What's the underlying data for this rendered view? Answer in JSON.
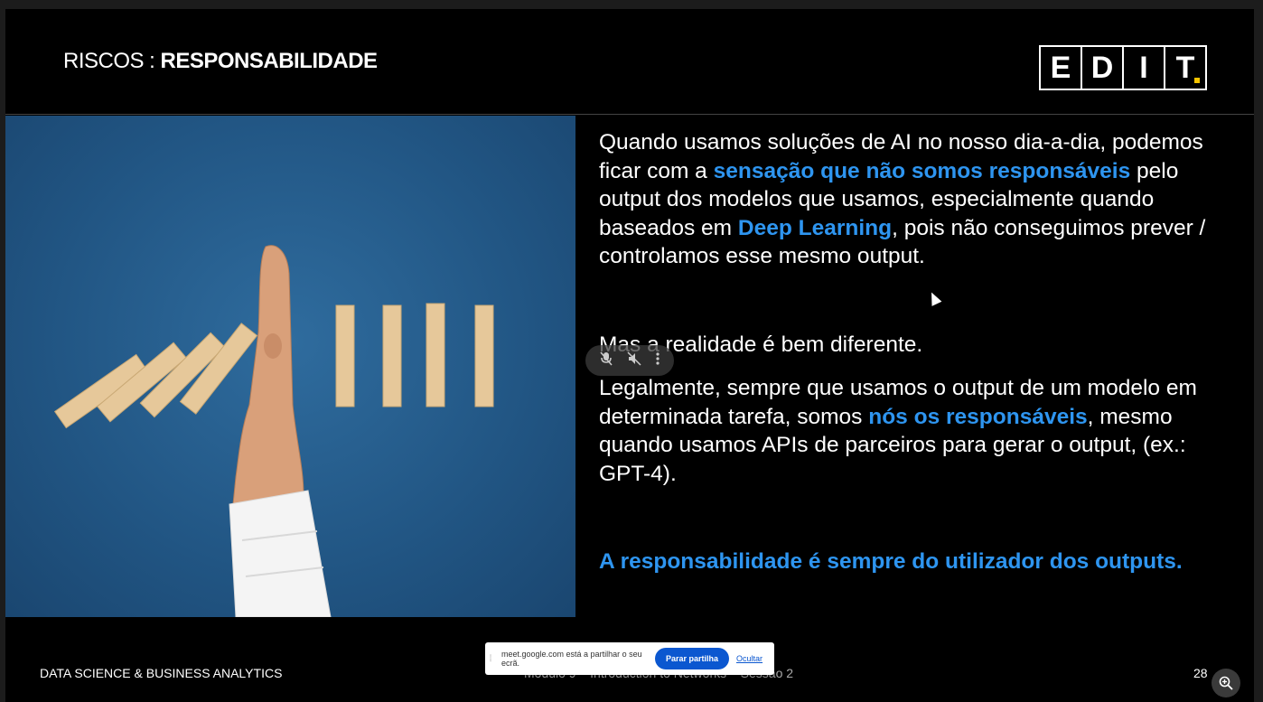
{
  "slide": {
    "title_prefix": "RISCOS : ",
    "title_bold": "RESPONSABILIDADE",
    "logo_letters": [
      "E",
      "D",
      "I",
      "T"
    ],
    "logo_dot_color": "#f5c400",
    "paragraph1": {
      "part1": "Quando usamos soluções de AI no nosso dia-a-dia, podemos ficar com a ",
      "hl1": "sensação que não somos responsáveis",
      "part2": " pelo output dos modelos que usamos, especialmente quando baseados em ",
      "hl2": "Deep Learning",
      "part3": ", pois não conseguimos prever / controlamos esse mesmo output."
    },
    "paragraph2": "Mas a realidade é bem diferente.",
    "paragraph3": {
      "part1": "Legalmente, sempre que usamos o output de um modelo em determinada tarefa, somos ",
      "hl1": "nós os responsáveis",
      "part2": ", mesmo quando usamos APIs de parceiros para gerar o output, (ex.: GPT-4)."
    },
    "paragraph4": "A responsabilidade é sempre do utilizador dos outputs.",
    "footer_left": "DATA SCIENCE & BUSINESS ANALYTICS",
    "footer_mid": "Módulo 9 – Introduction to Networks – Sessão 2",
    "page_number": "28",
    "highlight_color": "#2e95f0"
  },
  "share_bar": {
    "message": "meet.google.com está a partilhar o seu ecrã.",
    "stop_label": "Parar partilha",
    "hide_label": "Ocultar"
  },
  "mini_controls": {
    "icons": [
      "mic-off-icon",
      "volume-off-icon",
      "more-vert-icon"
    ]
  },
  "zoom": {
    "icon": "zoom-in-icon"
  }
}
